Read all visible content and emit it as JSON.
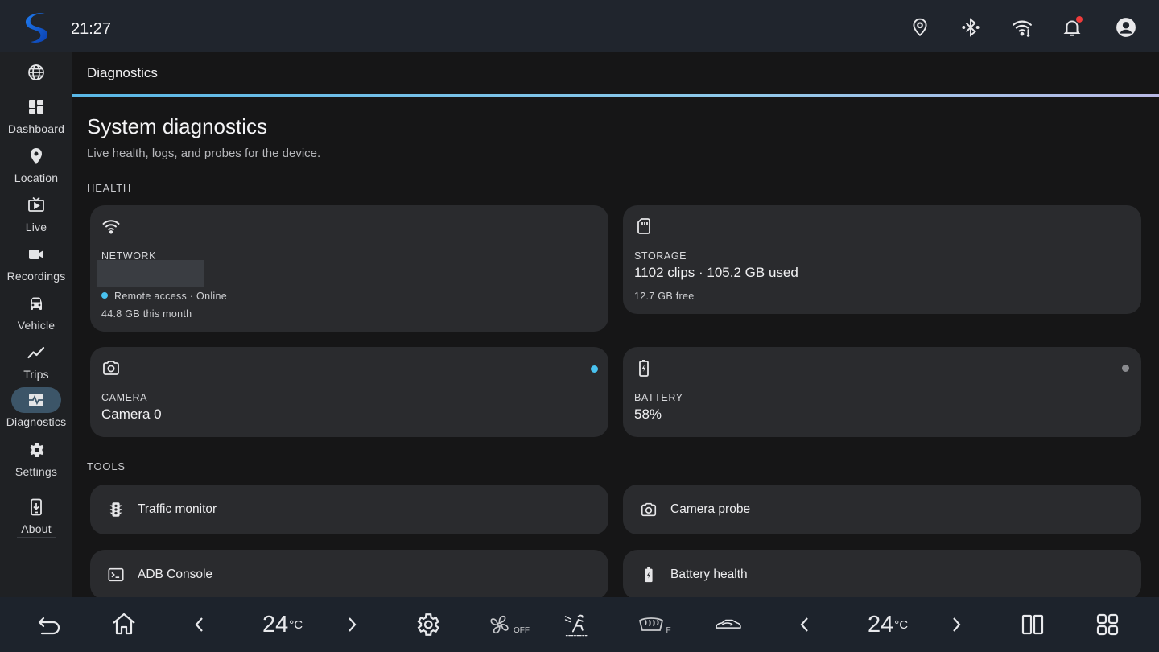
{
  "status_bar": {
    "time": "21:27",
    "icons": [
      "location-pin-icon",
      "bluetooth-icon",
      "wifi-icon",
      "bell-icon",
      "account-icon"
    ]
  },
  "nav_rail": {
    "items": [
      {
        "id": "globe",
        "label": "",
        "icon": "globe-icon"
      },
      {
        "id": "dashboard",
        "label": "Dashboard",
        "icon": "dashboard-icon"
      },
      {
        "id": "location",
        "label": "Location",
        "icon": "location-icon"
      },
      {
        "id": "live",
        "label": "Live",
        "icon": "live-tv-icon"
      },
      {
        "id": "recordings",
        "label": "Recordings",
        "icon": "videocam-icon"
      },
      {
        "id": "vehicle",
        "label": "Vehicle",
        "icon": "car-icon"
      },
      {
        "id": "trips",
        "label": "Trips",
        "icon": "trend-line-icon"
      },
      {
        "id": "diagnostics",
        "label": "Diagnostics",
        "icon": "monitor-heart-icon",
        "active": true
      },
      {
        "id": "settings",
        "label": "Settings",
        "icon": "gear-icon"
      },
      {
        "id": "about",
        "label": "About",
        "icon": "system-update-icon"
      }
    ]
  },
  "topbar": {
    "title": "Diagnostics"
  },
  "page": {
    "title": "System diagnostics",
    "subtitle": "Live health, logs, and probes for the device."
  },
  "health": {
    "section_label": "HEALTH",
    "network": {
      "label": "NETWORK",
      "status": "Remote access · Online",
      "usage": "44.8 GB this month",
      "status_color": "#49c2ef"
    },
    "storage": {
      "label": "STORAGE",
      "value": "1102 clips · 105.2 GB used",
      "free": "12.7 GB free"
    },
    "camera": {
      "label": "CAMERA",
      "value": "Camera 0",
      "dot_color": "#49c2ef"
    },
    "battery": {
      "label": "BATTERY",
      "value": "58%",
      "dot_color": "#8a8b8f"
    }
  },
  "tools": {
    "section_label": "TOOLS",
    "items": [
      {
        "label": "Traffic monitor",
        "icon": "traffic-light-icon"
      },
      {
        "label": "Camera probe",
        "icon": "camera-icon"
      },
      {
        "label": "ADB Console",
        "icon": "terminal-icon"
      },
      {
        "label": "Battery health",
        "icon": "battery-charging-icon"
      }
    ]
  },
  "bottom_bar": {
    "left_temp": "24",
    "right_temp": "24",
    "temp_unit": "°C",
    "fan_state": "OFF",
    "defrost_label": "F"
  },
  "colors": {
    "accent": "#49c2ef",
    "active_nav": "#3c5568",
    "card": "#2a2b2e",
    "alert": "#ef3b3b"
  }
}
